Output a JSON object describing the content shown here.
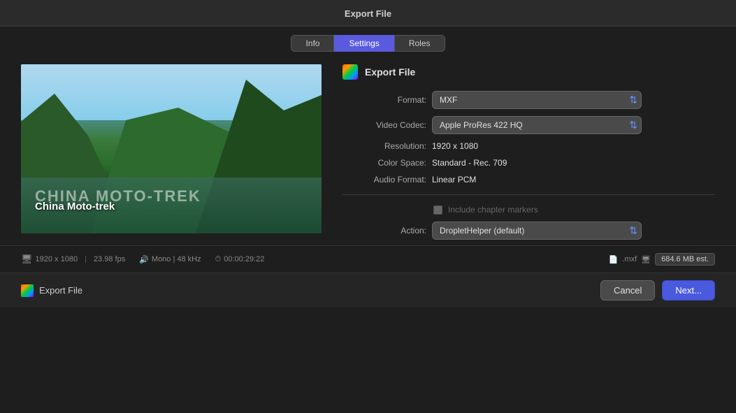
{
  "window": {
    "title": "Export File"
  },
  "tabs": {
    "items": [
      {
        "label": "Info",
        "active": false
      },
      {
        "label": "Settings",
        "active": true
      },
      {
        "label": "Roles",
        "active": false
      }
    ]
  },
  "export_header": {
    "title": "Export File"
  },
  "settings": {
    "format_label": "Format:",
    "format_value": "MXF",
    "video_codec_label": "Video Codec:",
    "video_codec_value": "Apple ProRes 422 HQ",
    "resolution_label": "Resolution:",
    "resolution_value": "1920 x 1080",
    "color_space_label": "Color Space:",
    "color_space_value": "Standard - Rec. 709",
    "audio_format_label": "Audio Format:",
    "audio_format_value": "Linear PCM",
    "chapter_markers_label": "Include chapter markers",
    "action_label": "Action:",
    "action_value": "DropletHelper (default)"
  },
  "video": {
    "title_text": "China Moto-trek",
    "watermark_text": "CHINA MOTO-TREK"
  },
  "status_bar": {
    "resolution": "1920 x 1080",
    "fps": "23.98 fps",
    "audio": "Mono | 48 kHz",
    "duration": "00:00:29:22",
    "file_ext": ".mxf",
    "file_size": "684.6 MB est."
  },
  "footer": {
    "export_label": "Export File",
    "cancel_label": "Cancel",
    "next_label": "Next..."
  }
}
